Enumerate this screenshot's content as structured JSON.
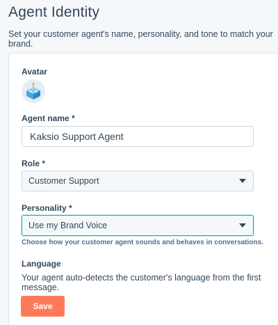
{
  "page": {
    "title": "Agent Identity",
    "subtitle": "Set your customer agent's name, personality, and tone to match your brand."
  },
  "avatar": {
    "label": "Avatar",
    "icon": "robot-avatar-icon"
  },
  "agent_name": {
    "label": "Agent name *",
    "value": "Kaksio Support Agent"
  },
  "role": {
    "label": "Role *",
    "selected": "Customer Support"
  },
  "personality": {
    "label": "Personality *",
    "selected": "Use my Brand Voice",
    "help": "Choose how your customer agent sounds and behaves in conversations."
  },
  "language": {
    "label": "Language",
    "text": "Your agent auto-detects the customer's language from the first message."
  },
  "actions": {
    "save_label": "Save"
  },
  "colors": {
    "background": "#f5f8fa",
    "text": "#33475b",
    "accent_button": "#ff7a59",
    "focus_border": "#00bda5"
  }
}
